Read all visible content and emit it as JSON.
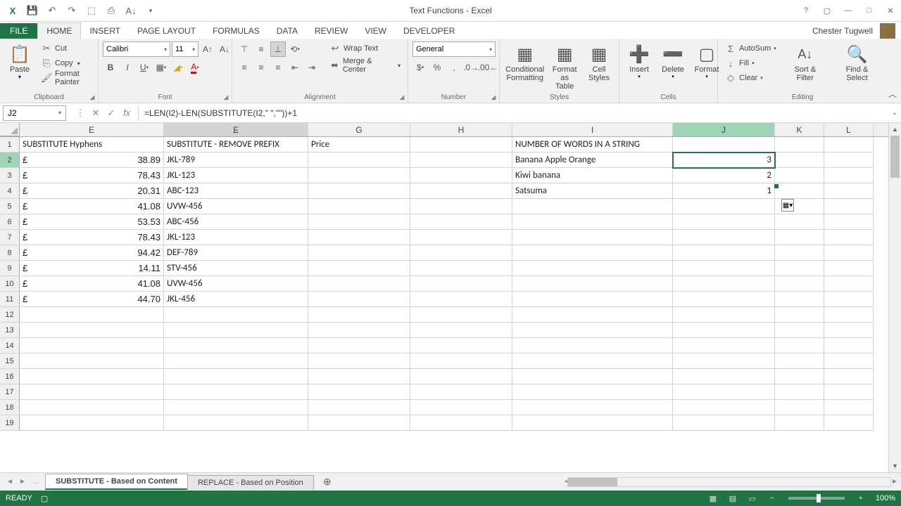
{
  "window": {
    "title": "Text Functions - Excel",
    "user": "Chester Tugwell"
  },
  "tabs": [
    "HOME",
    "INSERT",
    "PAGE LAYOUT",
    "FORMULAS",
    "DATA",
    "REVIEW",
    "VIEW",
    "DEVELOPER"
  ],
  "active_tab": "HOME",
  "ribbon": {
    "clipboard": {
      "label": "Clipboard",
      "paste": "Paste",
      "cut": "Cut",
      "copy": "Copy",
      "fmtp": "Format Painter"
    },
    "font": {
      "label": "Font",
      "name": "Calibri",
      "size": "11"
    },
    "alignment": {
      "label": "Alignment",
      "wrap": "Wrap Text",
      "merge": "Merge & Center"
    },
    "number": {
      "label": "Number",
      "fmt": "General"
    },
    "styles": {
      "label": "Styles",
      "cond": "Conditional Formatting",
      "table": "Format as Table",
      "cell": "Cell Styles"
    },
    "cells": {
      "label": "Cells",
      "insert": "Insert",
      "delete": "Delete",
      "format": "Format"
    },
    "editing": {
      "label": "Editing",
      "sum": "AutoSum",
      "fill": "Fill",
      "clear": "Clear",
      "sort": "Sort & Filter",
      "find": "Find & Select"
    }
  },
  "namebox": "J2",
  "formula": "=LEN(I2)-LEN(SUBSTITUTE(I2,\" \",\"\"))+1",
  "columns": [
    "E",
    "F",
    "G",
    "H",
    "I",
    "J",
    "K",
    "L"
  ],
  "row_count": 19,
  "headers": {
    "E": "SUBSTITUTE Hyphens",
    "F": "SUBSTITUTE - REMOVE PREFIX",
    "G": "Price",
    "I": "NUMBER OF WORDS IN A STRING"
  },
  "colE": [
    "38.89",
    "78.43",
    "20.31",
    "41.08",
    "53.53",
    "78.43",
    "94.42",
    "14.11",
    "41.08",
    "44.70"
  ],
  "colF": [
    "JKL-789",
    "JKL-123",
    "ABC-123",
    "UVW-456",
    "ABC-456",
    "JKL-123",
    "DEF-789",
    "STV-456",
    "UVW-456",
    "JKL-456"
  ],
  "colI": [
    "Banana Apple Orange",
    "Kiwi banana",
    "Satsuma"
  ],
  "colJ": [
    "3",
    "2",
    "1"
  ],
  "currency": "£",
  "sheets": {
    "active": "SUBSTITUTE - Based on Content",
    "other": "REPLACE - Based on Position"
  },
  "status": {
    "ready": "READY",
    "zoom": "100%"
  }
}
